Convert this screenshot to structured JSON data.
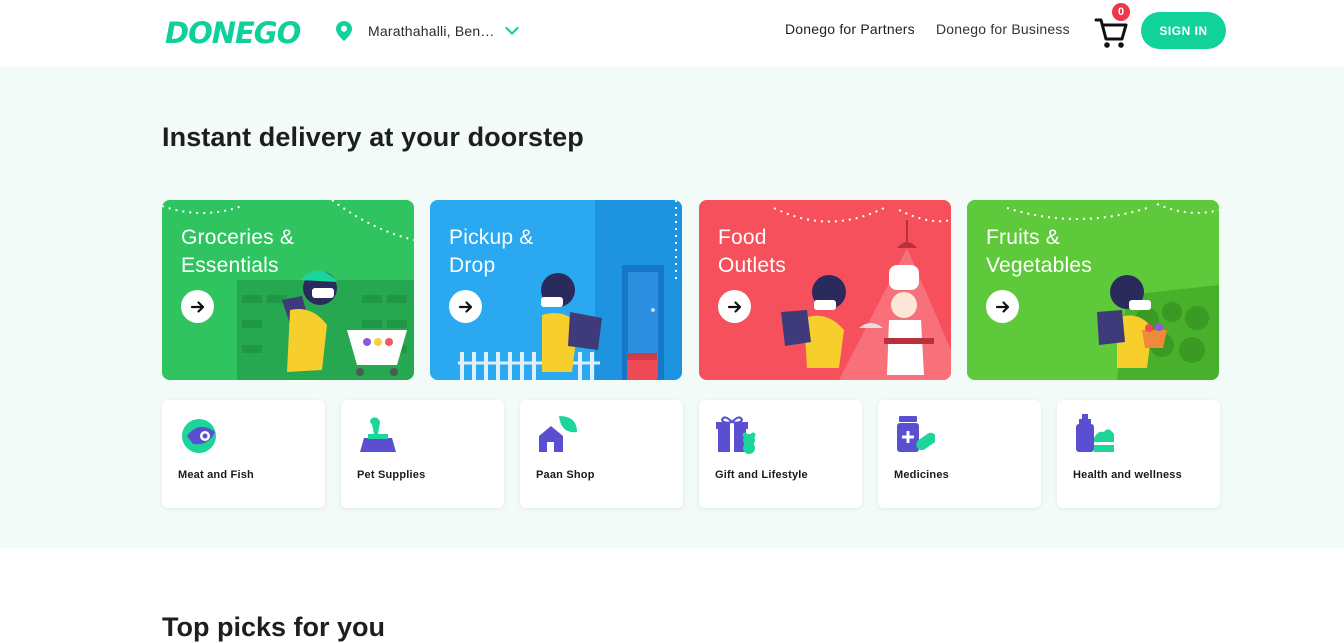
{
  "header": {
    "logo_text": "DONEGO",
    "location": "Marathahalli, Ben…",
    "links": [
      "Donego for Partners",
      "Donego for Business"
    ],
    "cart_count": "0",
    "signin_label": "SIGN IN"
  },
  "hero": {
    "title": "Instant delivery at your doorstep",
    "cards": [
      {
        "title": "Groceries &\nEssentials",
        "color": "#2fc45f"
      },
      {
        "title": "Pickup &\nDrop",
        "color": "#2aa8f0"
      },
      {
        "title": "Food\nOutlets",
        "color": "#f5505c"
      },
      {
        "title": "Fruits &\nVegetables",
        "color": "#5fc93c"
      }
    ],
    "categories": [
      {
        "label": "Meat and Fish",
        "icon": "meat-fish-icon"
      },
      {
        "label": "Pet Supplies",
        "icon": "pet-supplies-icon"
      },
      {
        "label": "Paan Shop",
        "icon": "paan-shop-icon"
      },
      {
        "label": "Gift and Lifestyle",
        "icon": "gift-icon"
      },
      {
        "label": "Medicines",
        "icon": "medicines-icon"
      },
      {
        "label": "Health and wellness",
        "icon": "health-wellness-icon"
      }
    ]
  },
  "section2": {
    "title": "Top picks for you"
  },
  "colors": {
    "accent": "#12d29c",
    "icon_purple": "#5b4fd1",
    "icon_green": "#1bd59a",
    "badge": "#f0364b"
  }
}
